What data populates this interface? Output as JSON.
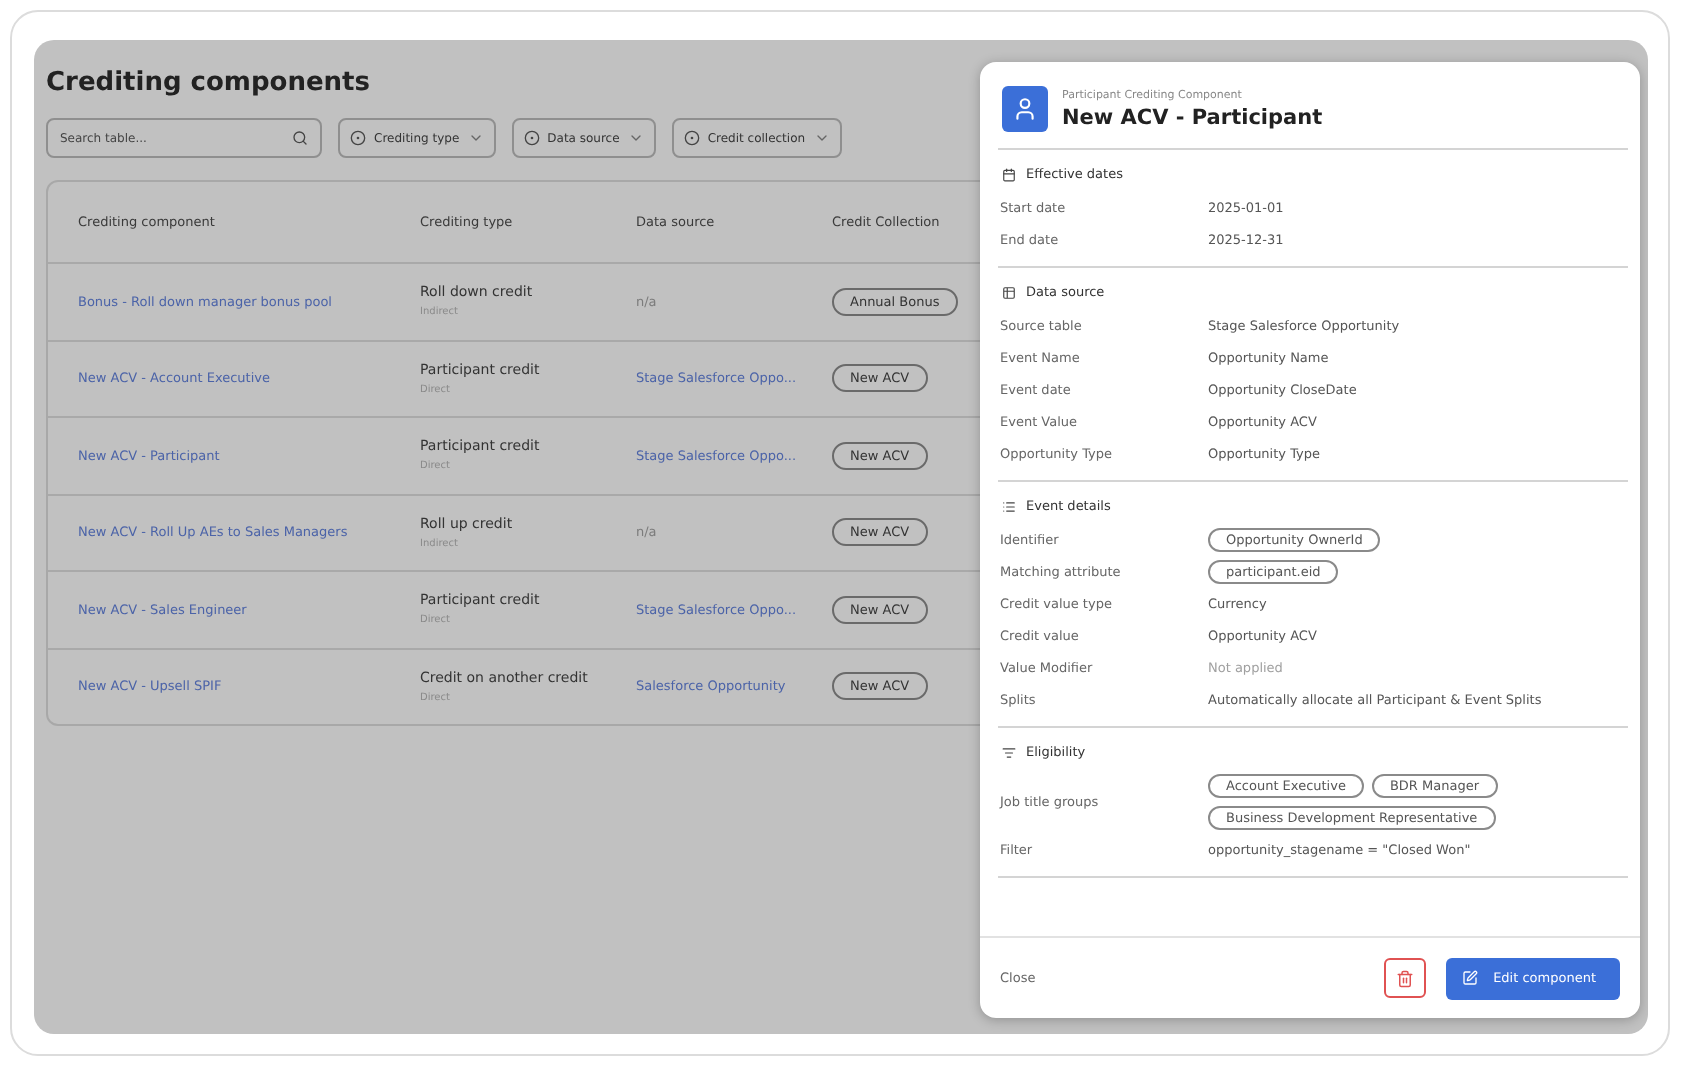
{
  "page": {
    "title": "Crediting components",
    "search": {
      "placeholder": "Search table..."
    },
    "filters": [
      {
        "label": "Crediting type"
      },
      {
        "label": "Data source"
      },
      {
        "label": "Credit collection"
      }
    ],
    "table": {
      "columns": [
        "Crediting component",
        "Crediting type",
        "Data source",
        "Credit Collection"
      ],
      "rows": [
        {
          "component": "Bonus - Roll down manager bonus pool",
          "type": "Roll down credit",
          "direction": "Indirect",
          "source": "n/a",
          "source_disabled": true,
          "collection": "Annual Bonus"
        },
        {
          "component": "New ACV - Account Executive",
          "type": "Participant credit",
          "direction": "Direct",
          "source": "Stage Salesforce Oppo...",
          "source_disabled": false,
          "collection": "New ACV"
        },
        {
          "component": "New ACV - Participant",
          "type": "Participant credit",
          "direction": "Direct",
          "source": "Stage Salesforce Oppo...",
          "source_disabled": false,
          "collection": "New ACV"
        },
        {
          "component": "New ACV - Roll Up AEs to Sales Managers",
          "type": "Roll up credit",
          "direction": "Indirect",
          "source": "n/a",
          "source_disabled": true,
          "collection": "New ACV"
        },
        {
          "component": "New ACV - Sales Engineer",
          "type": "Participant credit",
          "direction": "Direct",
          "source": "Stage Salesforce Oppo...",
          "source_disabled": false,
          "collection": "New ACV"
        },
        {
          "component": "New ACV - Upsell SPIF",
          "type": "Credit on another credit",
          "direction": "Direct",
          "source": "Salesforce Opportunity",
          "source_disabled": false,
          "collection": "New ACV"
        }
      ]
    }
  },
  "panel": {
    "subtitle": "Participant Crediting Component",
    "title": "New ACV - Participant",
    "sections": [
      {
        "kind": "calendar",
        "title": "Effective dates",
        "rows": [
          {
            "label": "Start date",
            "kind": "text",
            "value": "2025-01-01"
          },
          {
            "label": "End date",
            "kind": "text",
            "value": "2025-12-31"
          }
        ]
      },
      {
        "kind": "table",
        "title": "Data source",
        "rows": [
          {
            "label": "Source table",
            "kind": "text",
            "value": "Stage Salesforce Opportunity"
          },
          {
            "label": "Event Name",
            "kind": "text",
            "value": "Opportunity Name"
          },
          {
            "label": "Event date",
            "kind": "text",
            "value": "Opportunity CloseDate"
          },
          {
            "label": "Event Value",
            "kind": "text",
            "value": "Opportunity ACV"
          },
          {
            "label": "Opportunity Type",
            "kind": "text",
            "value": "Opportunity Type"
          }
        ]
      },
      {
        "kind": "list",
        "title": "Event details",
        "rows": [
          {
            "label": "Identifier",
            "kind": "chips",
            "chips": [
              "Opportunity OwnerId"
            ]
          },
          {
            "label": "Matching attribute",
            "kind": "chips",
            "chips": [
              "participant.eid"
            ]
          },
          {
            "label": "Credit value type",
            "kind": "text",
            "value": "Currency"
          },
          {
            "label": "Credit value",
            "kind": "text",
            "value": "Opportunity ACV"
          },
          {
            "label": "Value Modifier",
            "kind": "muted",
            "value": "Not applied"
          },
          {
            "label": "Splits",
            "kind": "text",
            "value": "Automatically allocate all Participant & Event Splits"
          }
        ]
      },
      {
        "kind": "filter",
        "title": "Eligibility",
        "rows": [
          {
            "label": "Job title groups",
            "kind": "chips",
            "chips": [
              "Account Executive",
              "BDR Manager",
              "Business Development Representative"
            ]
          },
          {
            "label": "Filter",
            "kind": "text",
            "value": "opportunity_stagename = \"Closed Won\""
          }
        ]
      }
    ],
    "close": "Close",
    "edit": "Edit component"
  }
}
